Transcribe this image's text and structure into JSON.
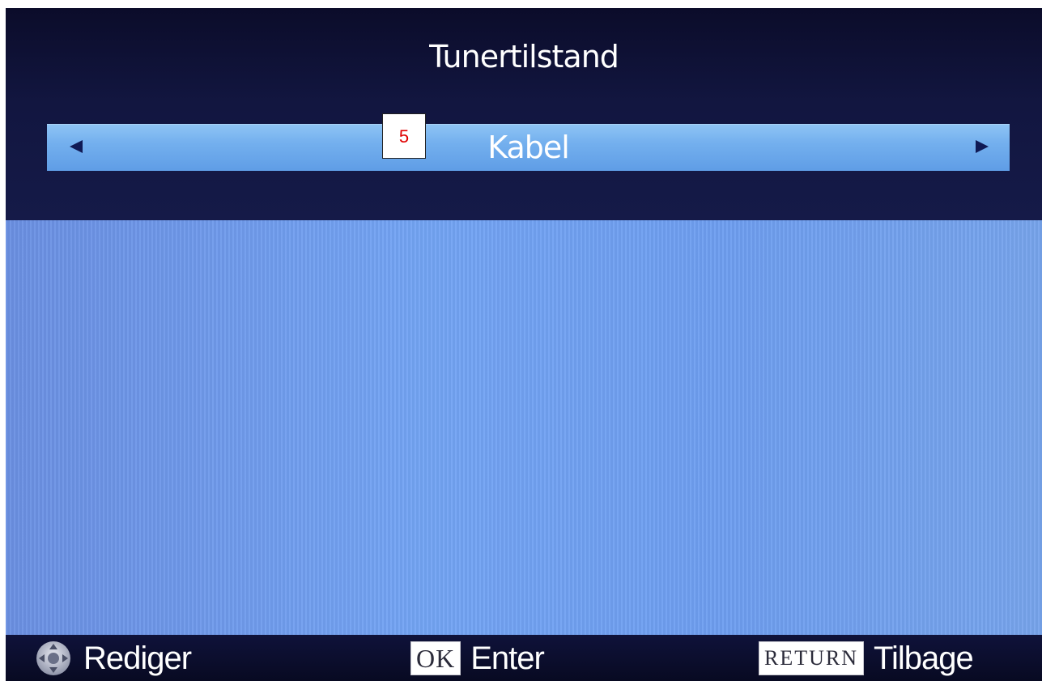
{
  "header": {
    "title": "Tunertilstand"
  },
  "selector": {
    "value": "Kabel",
    "left_arrow": "left-arrow-icon",
    "right_arrow": "right-arrow-icon"
  },
  "marker": {
    "label": "5"
  },
  "footer": {
    "edit": {
      "icon": "dpad-icon",
      "label": "Rediger"
    },
    "enter": {
      "key": "OK",
      "label": "Enter"
    },
    "back": {
      "key": "RETURN",
      "label": "Tilbage"
    }
  },
  "colors": {
    "header_bg": "#121640",
    "selector_bg": "#74b0ee",
    "content_bg": "#6f98e6",
    "footer_bg": "#0b0d2c",
    "marker_text": "#e00000"
  }
}
